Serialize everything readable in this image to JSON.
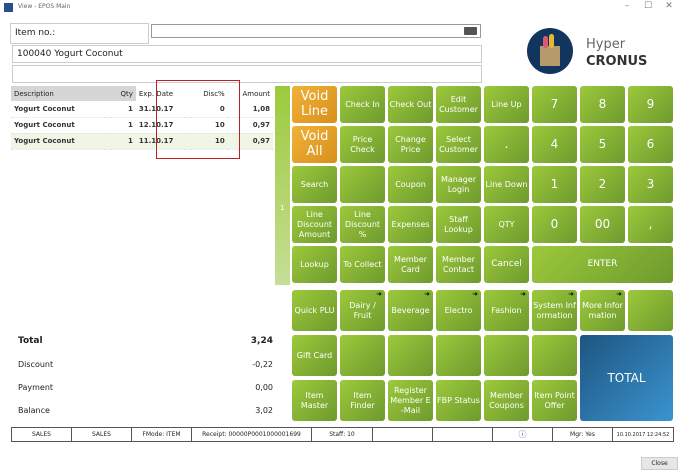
{
  "window": {
    "title": "View - EPOS Main",
    "minimize": "–",
    "maximize": "☐",
    "close": "✕"
  },
  "brand": {
    "line1": "Hyper",
    "line2": "CRONUS"
  },
  "item_no": {
    "label": "Item no.:",
    "value": ""
  },
  "selected_item": "100040 Yogurt Coconut",
  "table": {
    "headers": [
      "Description",
      "Qty",
      "Exp. Date",
      "Disc%",
      "Amount"
    ],
    "rows": [
      [
        "Yogurt Coconut",
        "1",
        "31.10.17",
        "0",
        "1,08"
      ],
      [
        "Yogurt Coconut",
        "1",
        "12.10.17",
        "10",
        "0,97"
      ],
      [
        "Yogurt Coconut",
        "1",
        "11.10.17",
        "10",
        "0,97"
      ]
    ]
  },
  "strip_label": "1",
  "totals": [
    {
      "label": "Total",
      "value": "3,24"
    },
    {
      "label": "Discount",
      "value": "-0,22"
    },
    {
      "label": "Payment",
      "value": "0,00"
    },
    {
      "label": "Balance",
      "value": "3,02"
    }
  ],
  "keys": {
    "void_line": "Void Line",
    "void_all": "Void All",
    "check_in": "Check In",
    "check_out": "Check Out",
    "edit_customer": "Edit Customer",
    "line_up": "Line Up",
    "k7": "7",
    "k8": "8",
    "k9": "9",
    "price_check": "Price Check",
    "change_price": "Change Price",
    "select_customer": "Select Customer",
    "dot": ".",
    "k4": "4",
    "k5": "5",
    "k6": "6",
    "search": "Search",
    "coupon": "Coupon",
    "manager_login": "Manager Login",
    "line_down": "Line Down",
    "k1": "1",
    "k2": "2",
    "k3": "3",
    "line_disc_amt": "Line Discount Amount",
    "line_disc_pct": "Line Discount %",
    "expenses": "Expenses",
    "staff_lookup": "Staff Lookup",
    "qty": "QTY",
    "k0": "0",
    "k00": "00",
    "comma": ",",
    "lookup": "Lookup",
    "to_collect": "To Collect",
    "member_card": "Member Card",
    "member_contact": "Member Contact",
    "cancel": "Cancel",
    "enter": "ENTER"
  },
  "menu": {
    "quick_plu": "Quick PLU",
    "dairy": "Dairy / Fruit",
    "beverage": "Beverage",
    "electro": "Electro",
    "fashion": "Fashion",
    "system_info": "System Information",
    "more_info": "More Information",
    "gift_card": "Gift Card",
    "total": "TOTAL",
    "item_master": "Item Master",
    "item_finder": "Item Finder",
    "register_email": "Register Member E -Mail",
    "fbp_status": "FBP Status",
    "member_coupons": "Member Coupons",
    "item_point_offer": "Item Point Offer",
    "submenu_arrow": "➜"
  },
  "status": {
    "c1": "SALES",
    "c2": "SALES",
    "fmode": "FMode: ITEM",
    "receipt": "Receipt: 00000P0001000001699",
    "staff": "Staff: 10",
    "info": "ⓘ",
    "mgr": "Mgr: Yes",
    "datetime": "10.10.2017 12:24:52"
  },
  "close_label": "Close",
  "colors": {
    "green": "#8ab833",
    "orange": "#e8a32a",
    "blue": "#2a78b0"
  }
}
